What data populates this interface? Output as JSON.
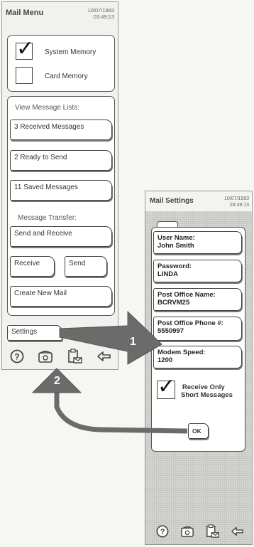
{
  "mail_menu": {
    "title": "Mail Menu",
    "date": "10/07/1993",
    "time": "03:49:13",
    "memory": {
      "system_label": "System Memory",
      "system_checked": true,
      "card_label": "Card Memory",
      "card_checked": false
    },
    "message_lists": {
      "heading": "View Message Lists:",
      "received": "3 Received Messages",
      "ready": "2 Ready to Send",
      "saved": "11 Saved Messages"
    },
    "transfer": {
      "heading": "Message Transfer:",
      "send_receive": "Send and Receive",
      "receive": "Receive",
      "send": "Send"
    },
    "create_new": "Create New Mail",
    "settings": "Settings"
  },
  "mail_settings": {
    "title": "Mail Settings",
    "date": "10/07/1993",
    "time": "03:49:13",
    "fields": {
      "user_name_label": "User Name:",
      "user_name_value": "John Smith",
      "password_label": "Password:",
      "password_value": "LINDA",
      "po_name_label": "Post Office Name:",
      "po_name_value": "BCRVM25",
      "po_phone_label": "Post Office Phone #:",
      "po_phone_value": "5550997",
      "modem_label": "Modem Speed:",
      "modem_value": "1200"
    },
    "short_messages_label_1": "Receive Only",
    "short_messages_label_2": "Short Messages",
    "short_messages_checked": true,
    "ok_label": "OK"
  },
  "toolbar_icons": [
    "help-icon",
    "phone-icon",
    "clipboard-icon",
    "back-arrow-icon"
  ],
  "callouts": {
    "arrow_1": "1",
    "arrow_2": "2"
  }
}
